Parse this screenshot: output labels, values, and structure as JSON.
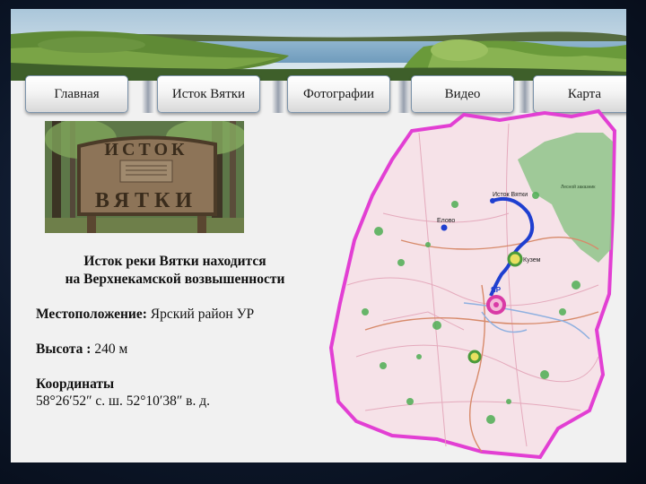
{
  "nav": {
    "items": [
      {
        "label": "Главная"
      },
      {
        "label": "Исток Вятки"
      },
      {
        "label": "Фотографии"
      },
      {
        "label": "Видео"
      },
      {
        "label": "Карта"
      }
    ]
  },
  "photo": {
    "sign_top": "ИСТОК",
    "sign_bottom": "ВЯТКИ"
  },
  "info": {
    "heading_line1": "Исток реки Вятки находится",
    "heading_line2": "на Верхнекамской возвышенности",
    "location_label": "Местоположение:",
    "location_value": "Ярский район УР",
    "height_label": "Высота :",
    "height_value": "240 м",
    "coords_label": "Координаты",
    "coords_value": "58°26′52″ с. ш. 52°10′38″ в. д."
  },
  "map": {
    "labels": {
      "source": "Исток Вятки",
      "yar": "ЯР",
      "kuzem": "Кузем",
      "yelovo": "Елово",
      "forest": "Лесной заказник"
    },
    "colors": {
      "border": "#e23fd3",
      "fill": "#f6e2e8",
      "river": "#1f3fd0",
      "forest": "#8fc48a"
    }
  },
  "colors": {
    "slide_bg": "#f1f1f1",
    "nav_border": "#7c93aa"
  }
}
